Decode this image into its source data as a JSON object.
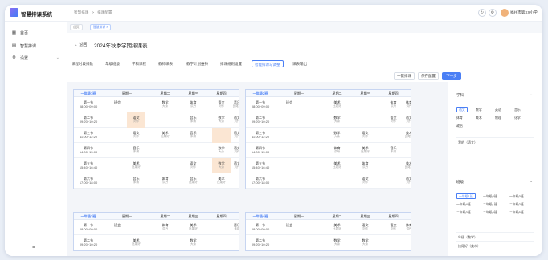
{
  "app": {
    "title": "智慧排课系统"
  },
  "breadcrumb": [
    "智慧排课",
    ">",
    "排课配置"
  ],
  "user": {
    "name": "福州市第XX小学"
  },
  "sidebar": {
    "items": [
      {
        "icon": "home-icon",
        "label": "首页"
      },
      {
        "icon": "calendar-icon",
        "label": "智慧排课"
      },
      {
        "icon": "gear-icon",
        "label": "设置"
      }
    ]
  },
  "page_tags": [
    "首页",
    "智慧排课 ×"
  ],
  "header": {
    "back": "返回",
    "title": "2024年秋季学期排课表"
  },
  "tabs": [
    "课程时段排数",
    "年级班级",
    "学科课程",
    "教师课表",
    "教学计划维持",
    "排课规则设置",
    "智能排课与调整",
    "课表输出"
  ],
  "active_tab": 6,
  "actions": {
    "one_click": "一键排课",
    "save": "保存配置",
    "next": "下一步"
  },
  "columns": [
    "星期一",
    "星期二",
    "星期三",
    "星期四",
    "星期五"
  ],
  "periods": [
    {
      "name": "第一节",
      "time": "08:00~09:00"
    },
    {
      "name": "第二节",
      "time": "09:20~10:20"
    },
    {
      "name": "第三节",
      "time": "11:00~12:20"
    },
    {
      "name": "第四节",
      "time": "14:00~15:00"
    },
    {
      "name": "第五节",
      "time": "15:40~16:40"
    },
    {
      "name": "第六节",
      "time": "17:00~18:00"
    }
  ],
  "timetables": [
    {
      "class": "一年级1班",
      "rows": [
        [
          [
            "班会",
            ""
          ],
          [
            "",
            ""
          ],
          [
            "数学",
            "大余"
          ],
          [
            "体育",
            "洪丹"
          ],
          [
            "语文",
            "刘作"
          ],
          [
            "音乐",
            "比尾好"
          ]
        ],
        [
          [
            "",
            ""
          ],
          [
            "语文",
            "刘作"
          ],
          [
            "",
            ""
          ],
          [
            "音乐",
            "朱琪"
          ],
          [
            "数学",
            "大余"
          ],
          [
            "语文",
            "刘作"
          ]
        ],
        [
          [
            "",
            ""
          ],
          [
            "语文",
            "刘作"
          ],
          [
            "美术",
            "比尾好"
          ],
          [
            "音乐",
            "朱琪"
          ],
          [
            "",
            ""
          ],
          [
            "语文",
            "刘作"
          ]
        ],
        [
          [
            "",
            ""
          ],
          [
            "音乐",
            "朱琪"
          ],
          [
            "",
            ""
          ],
          [
            "",
            ""
          ],
          [
            "数学",
            "大余"
          ],
          [
            "语文",
            "刘作"
          ]
        ],
        [
          [
            "",
            ""
          ],
          [
            "美术",
            "比尾好"
          ],
          [
            "",
            ""
          ],
          [
            "语文",
            "刘作"
          ],
          [
            "数学",
            "大余"
          ],
          [
            "语文",
            "刘作"
          ]
        ],
        [
          [
            "",
            ""
          ],
          [
            "音乐",
            "朱琪"
          ],
          [
            "体育",
            "洪丹"
          ],
          [
            "音乐",
            "比尾好"
          ],
          [
            "美术",
            "比尾好"
          ],
          [
            "",
            ""
          ]
        ]
      ],
      "hl": [
        [
          1,
          1
        ],
        [
          2,
          4
        ],
        [
          4,
          4
        ]
      ]
    },
    {
      "class": "一年级2班",
      "rows": [
        [
          [
            "班会",
            ""
          ],
          [
            "",
            ""
          ],
          [
            "美术",
            "比尾好"
          ],
          [
            "",
            ""
          ],
          [
            "体育",
            "洪丹"
          ],
          [
            "体育",
            "洪丹"
          ]
        ],
        [
          [
            "",
            ""
          ],
          [
            "",
            ""
          ],
          [
            "数学",
            "大余"
          ],
          [
            "",
            ""
          ],
          [
            "语文",
            "刘作"
          ],
          [
            "语文",
            "刘作"
          ]
        ],
        [
          [
            "",
            ""
          ],
          [
            "",
            ""
          ],
          [
            "数学",
            "大余"
          ],
          [
            "语文",
            "刘作"
          ],
          [
            "",
            ""
          ],
          [
            "美术",
            "比尾好"
          ]
        ],
        [
          [
            "",
            ""
          ],
          [
            "",
            ""
          ],
          [
            "体育",
            "洪丹"
          ],
          [
            "美术",
            "比尾好"
          ],
          [
            "音乐",
            "朱琪"
          ],
          [
            "",
            ""
          ]
        ],
        [
          [
            "",
            ""
          ],
          [
            "",
            ""
          ],
          [
            "美术",
            "比尾好"
          ],
          [
            "体育",
            "洪丹"
          ],
          [
            "",
            ""
          ],
          [
            "美术",
            "比尾好"
          ]
        ],
        [
          [
            "",
            ""
          ],
          [
            "",
            ""
          ],
          [
            "",
            ""
          ],
          [
            "语文",
            "刘作"
          ],
          [
            "",
            ""
          ],
          [
            "语文",
            "刘作"
          ]
        ]
      ],
      "hl": []
    },
    {
      "class": "一年级3班",
      "rows": [
        [
          [
            "班会",
            ""
          ],
          [
            "",
            ""
          ],
          [
            "体育",
            "洪丹"
          ],
          [
            "美术",
            "比尾好"
          ],
          [
            "",
            ""
          ],
          [
            "音乐",
            "朱琪"
          ]
        ],
        [
          [
            "",
            ""
          ],
          [
            "美术",
            "比尾好"
          ],
          [
            "",
            ""
          ],
          [
            "数学",
            "大余"
          ],
          [
            "",
            ""
          ],
          [
            "",
            ""
          ]
        ]
      ],
      "hl": []
    },
    {
      "class": "一年级4班",
      "rows": [
        [
          [
            "班会",
            ""
          ],
          [
            "",
            ""
          ],
          [
            "美术",
            "比尾好"
          ],
          [
            "语文",
            "刘作"
          ],
          [
            "语文",
            "刘作"
          ],
          [
            "体育",
            "洪丹"
          ]
        ],
        [
          [
            "",
            ""
          ],
          [
            "",
            ""
          ],
          [
            "数学",
            "大余"
          ],
          [
            "数学",
            "大余"
          ],
          [
            "",
            ""
          ],
          [
            "",
            ""
          ]
        ]
      ],
      "hl": []
    }
  ],
  "right_panel": {
    "subject_section": {
      "label": "学科",
      "options": [
        "语文",
        "数学",
        "英语",
        "音乐",
        "体育",
        "美术",
        "物理",
        "化学",
        "政治"
      ],
      "selected": 0
    },
    "subject_selected_text": "我的（语文）",
    "class_section": {
      "label": "班级",
      "options": [
        "一年级1班",
        "一年级2班",
        "一年级3班",
        "一年级4班",
        "二年级1班",
        "二年级2班",
        "二年级3班",
        "二年级4班",
        "二年级5班"
      ],
      "selected": 0
    },
    "class_list": [
      "年级（数学）",
      "比尾好（美术）"
    ]
  }
}
